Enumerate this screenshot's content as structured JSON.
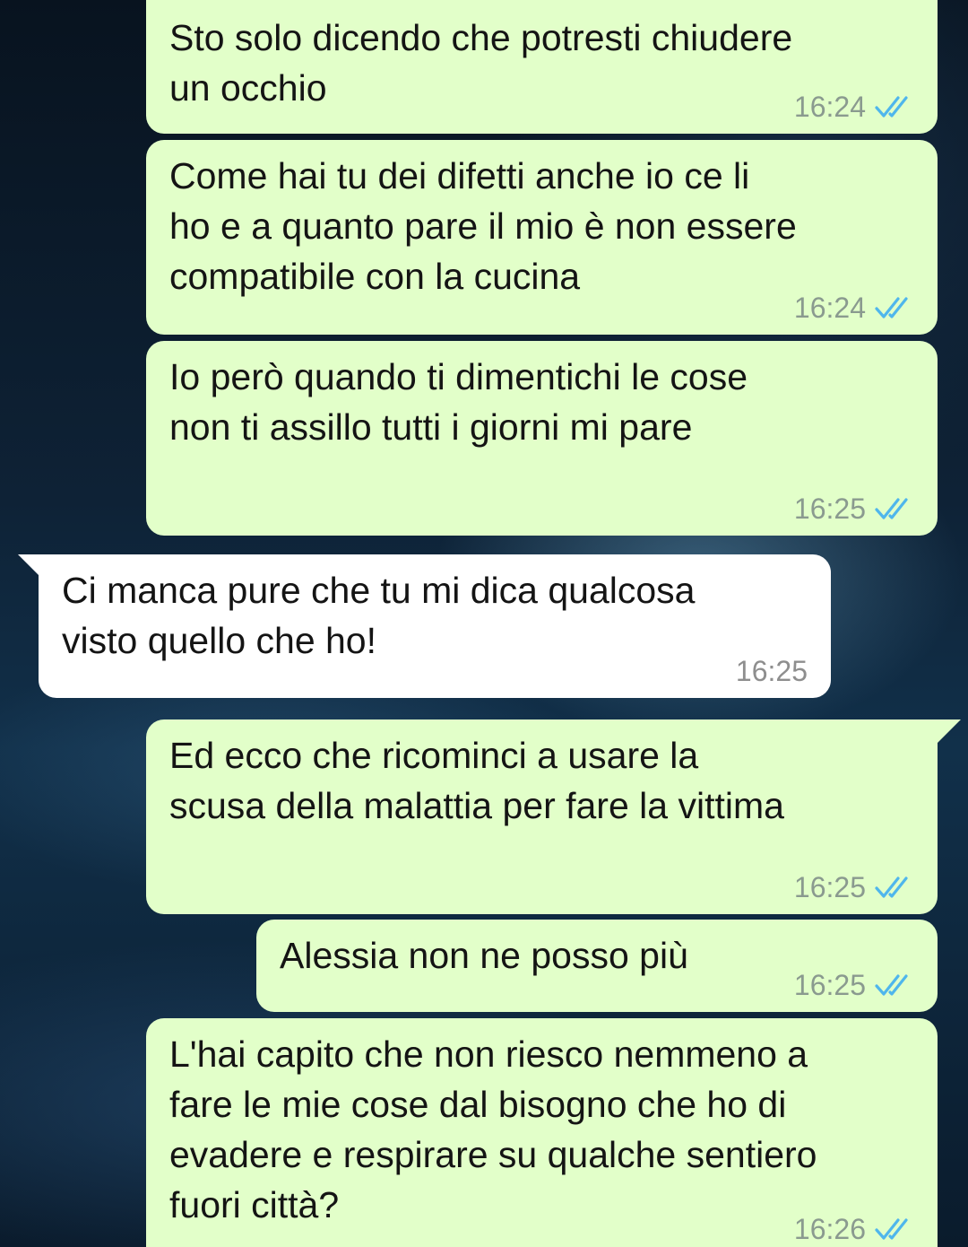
{
  "messages": [
    {
      "direction": "outgoing",
      "text": "Sto solo dicendo che potresti chiudere\nun occhio",
      "time": "16:24",
      "status": "read"
    },
    {
      "direction": "outgoing",
      "text": "Come hai tu dei difetti anche io ce li\nho e a quanto pare il mio è non essere\ncompatibile con la cucina",
      "time": "16:24",
      "status": "read"
    },
    {
      "direction": "outgoing",
      "text": "Io però quando ti dimentichi le cose\nnon ti assillo tutti i giorni mi pare",
      "time": "16:25",
      "status": "read"
    },
    {
      "direction": "incoming",
      "text": "Ci manca pure che tu mi dica qualcosa\nvisto quello che ho!",
      "time": "16:25"
    },
    {
      "direction": "outgoing",
      "text": "Ed ecco che ricominci a usare la\nscusa della malattia per fare la vittima",
      "time": "16:25",
      "status": "read"
    },
    {
      "direction": "outgoing",
      "text": "Alessia non ne posso più",
      "time": "16:25",
      "status": "read"
    },
    {
      "direction": "outgoing",
      "text": "L'hai capito che non riesco nemmeno a\nfare le mie cose dal bisogno che ho di\nevadere e respirare su qualche sentiero\nfuori città?",
      "time": "16:26",
      "status": "read"
    }
  ],
  "colors": {
    "outgoing_bubble": "#e2ffc9",
    "incoming_bubble": "#ffffff",
    "read_ticks": "#4fb6ec"
  }
}
